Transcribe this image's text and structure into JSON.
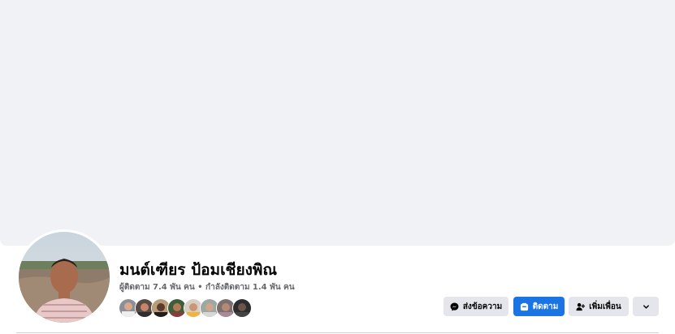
{
  "profile": {
    "name": "มนต์เฑียร ป้อมเชียงพิณ",
    "followers_label": "ผู้ติดตาม",
    "followers_count": "7.4 พัน คน",
    "separator": " • ",
    "following_label": "กำลังติดตาม",
    "following_count": "1.4 พัน คน"
  },
  "friend_avatars": [
    "friend-avatar-1",
    "friend-avatar-2",
    "friend-avatar-3",
    "friend-avatar-4",
    "friend-avatar-5",
    "friend-avatar-6",
    "friend-avatar-7",
    "friend-avatar-8"
  ],
  "actions": {
    "message_label": "ส่งข้อความ",
    "follow_label": "ติดตาม",
    "add_friend_label": "เพิ่มเพื่อน"
  },
  "icons": {
    "message": "messenger-icon",
    "follow": "follow-icon",
    "add_friend": "add-friend-icon",
    "more": "chevron-down-icon"
  },
  "colors": {
    "primary_button": "#1b74e4",
    "secondary_button": "#e4e6eb",
    "cover_background": "#f0f2f5"
  }
}
